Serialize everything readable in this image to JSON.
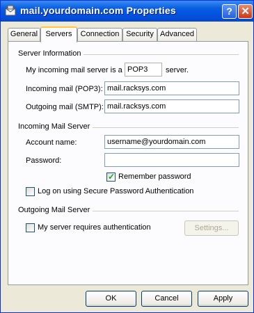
{
  "window": {
    "title": "mail.yourdomain.com Properties"
  },
  "tabs": [
    {
      "label": "General"
    },
    {
      "label": "Servers"
    },
    {
      "label": "Connection"
    },
    {
      "label": "Security"
    },
    {
      "label": "Advanced"
    }
  ],
  "server_info": {
    "heading": "Server Information",
    "prefix_label": "My incoming mail server is a",
    "server_type": "POP3",
    "suffix_label": "server.",
    "incoming_label": "Incoming mail (POP3):",
    "incoming_value": "mail.racksys.com",
    "outgoing_label": "Outgoing mail (SMTP):",
    "outgoing_value": "mail.racksys.com"
  },
  "incoming_server": {
    "heading": "Incoming Mail Server",
    "account_label": "Account name:",
    "account_value": "username@yourdomain.com",
    "password_label": "Password:",
    "password_value": "",
    "remember_label": "Remember password",
    "remember_checked": true,
    "spa_label": "Log on using Secure Password Authentication",
    "spa_checked": false
  },
  "outgoing_server": {
    "heading": "Outgoing Mail Server",
    "auth_label": "My server requires authentication",
    "auth_checked": false,
    "settings_label": "Settings..."
  },
  "footer": {
    "ok_label": "OK",
    "cancel_label": "Cancel",
    "apply_label": "Apply"
  }
}
